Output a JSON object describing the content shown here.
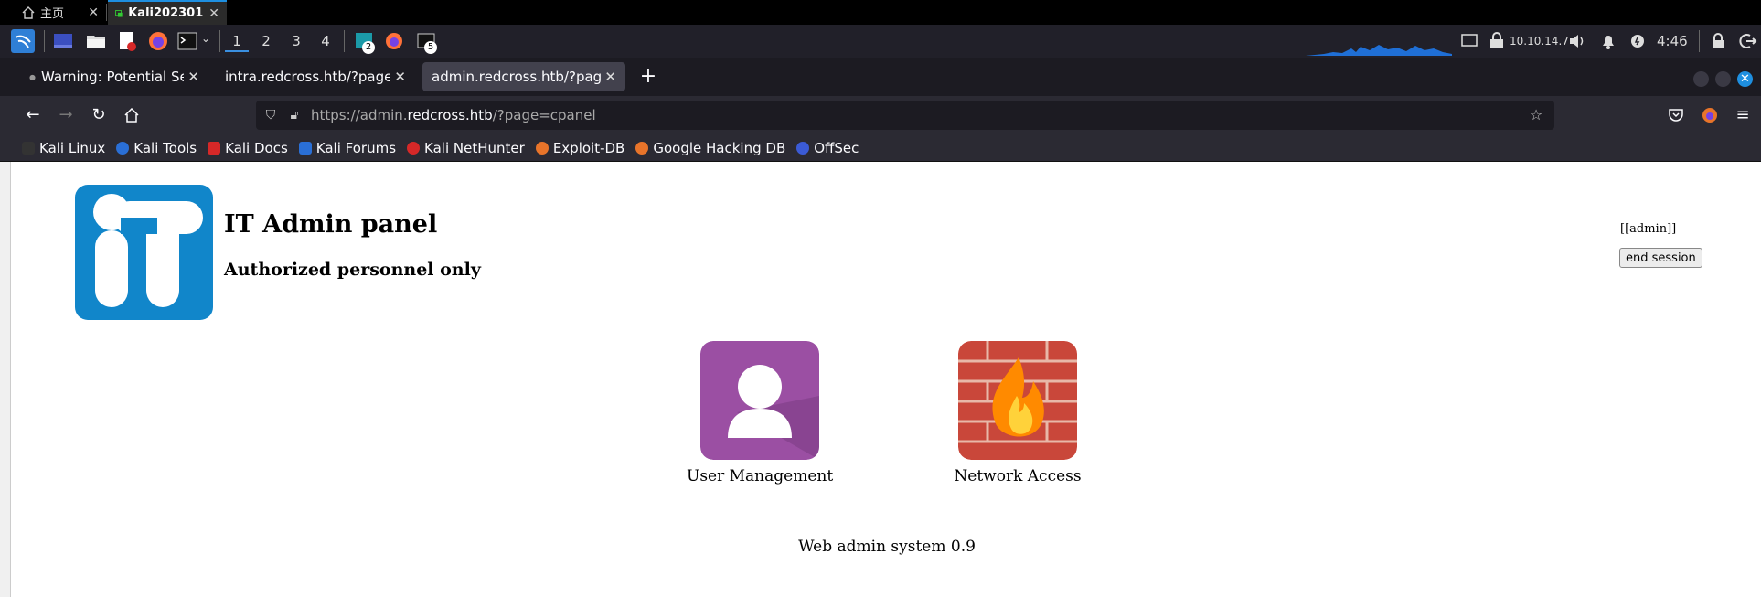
{
  "vm_tabs": {
    "home": "主页",
    "vm": "Kali202301"
  },
  "panel": {
    "workspaces": [
      "1",
      "2",
      "3",
      "4"
    ],
    "badge_a": "2",
    "badge_b": "5",
    "ip": "10.10.14.7",
    "clock": "4:46"
  },
  "browser": {
    "tabs": [
      {
        "label": "Warning: Potential Security Risk Ahead"
      },
      {
        "label": "intra.redcross.htb/?page=login"
      },
      {
        "label": "admin.redcross.htb/?page=cpanel"
      }
    ],
    "url_prefix": "https://admin.",
    "url_host": "redcross.htb",
    "url_rest": "/?page=cpanel",
    "bookmarks": [
      {
        "label": "Kali Linux",
        "color": "#333"
      },
      {
        "label": "Kali Tools",
        "color": "#2a6fd6"
      },
      {
        "label": "Kali Docs",
        "color": "#d62828"
      },
      {
        "label": "Kali Forums",
        "color": "#2a6fd6"
      },
      {
        "label": "Kali NetHunter",
        "color": "#d62828"
      },
      {
        "label": "Exploit-DB",
        "color": "#e8742a"
      },
      {
        "label": "Google Hacking DB",
        "color": "#e8742a"
      },
      {
        "label": "OffSec",
        "color": "#3b5bd6"
      }
    ]
  },
  "content": {
    "title": "IT Admin panel",
    "subtitle": "Authorized personnel only",
    "user_tag": "[[admin]]",
    "end_session": "end session",
    "tiles": [
      {
        "label": "User Management",
        "icon": "user-icon"
      },
      {
        "label": "Network Access",
        "icon": "firewall-icon"
      }
    ],
    "footer": "Web admin system 0.9"
  }
}
